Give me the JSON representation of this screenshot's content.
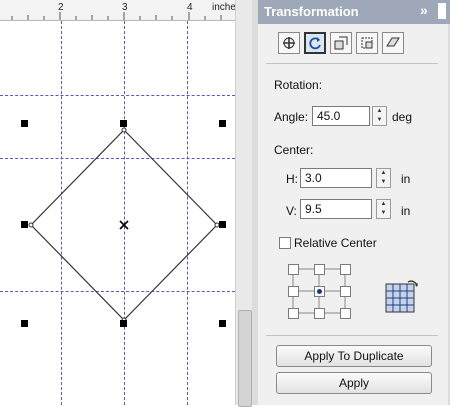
{
  "ruler": {
    "ticks": [
      "2",
      "3",
      "4"
    ],
    "unit": "inches"
  },
  "panel": {
    "title": "Transformation",
    "collapse_icon": "double-chevron-right-icon",
    "close_icon": "close-icon",
    "tool_icons": [
      "position-icon",
      "rotate-icon",
      "scale-mirror-icon",
      "size-icon",
      "skew-icon"
    ],
    "active_tool": "rotate-icon",
    "rotation": {
      "section_label": "Rotation:",
      "angle_label": "Angle:",
      "angle_value": "45.0",
      "angle_unit": "deg"
    },
    "center": {
      "section_label": "Center:",
      "h_label": "H:",
      "h_value": "3.0",
      "h_unit": "in",
      "v_label": "V:",
      "v_value": "9.5",
      "v_unit": "in"
    },
    "relative_center": {
      "label": "Relative Center",
      "checked": false
    },
    "anchor_selected": "center",
    "apply_to_duplicate_label": "Apply To Duplicate",
    "apply_label": "Apply"
  },
  "colors": {
    "guideline": "#5a5ab8",
    "title_bar": "#9ea8b8"
  }
}
